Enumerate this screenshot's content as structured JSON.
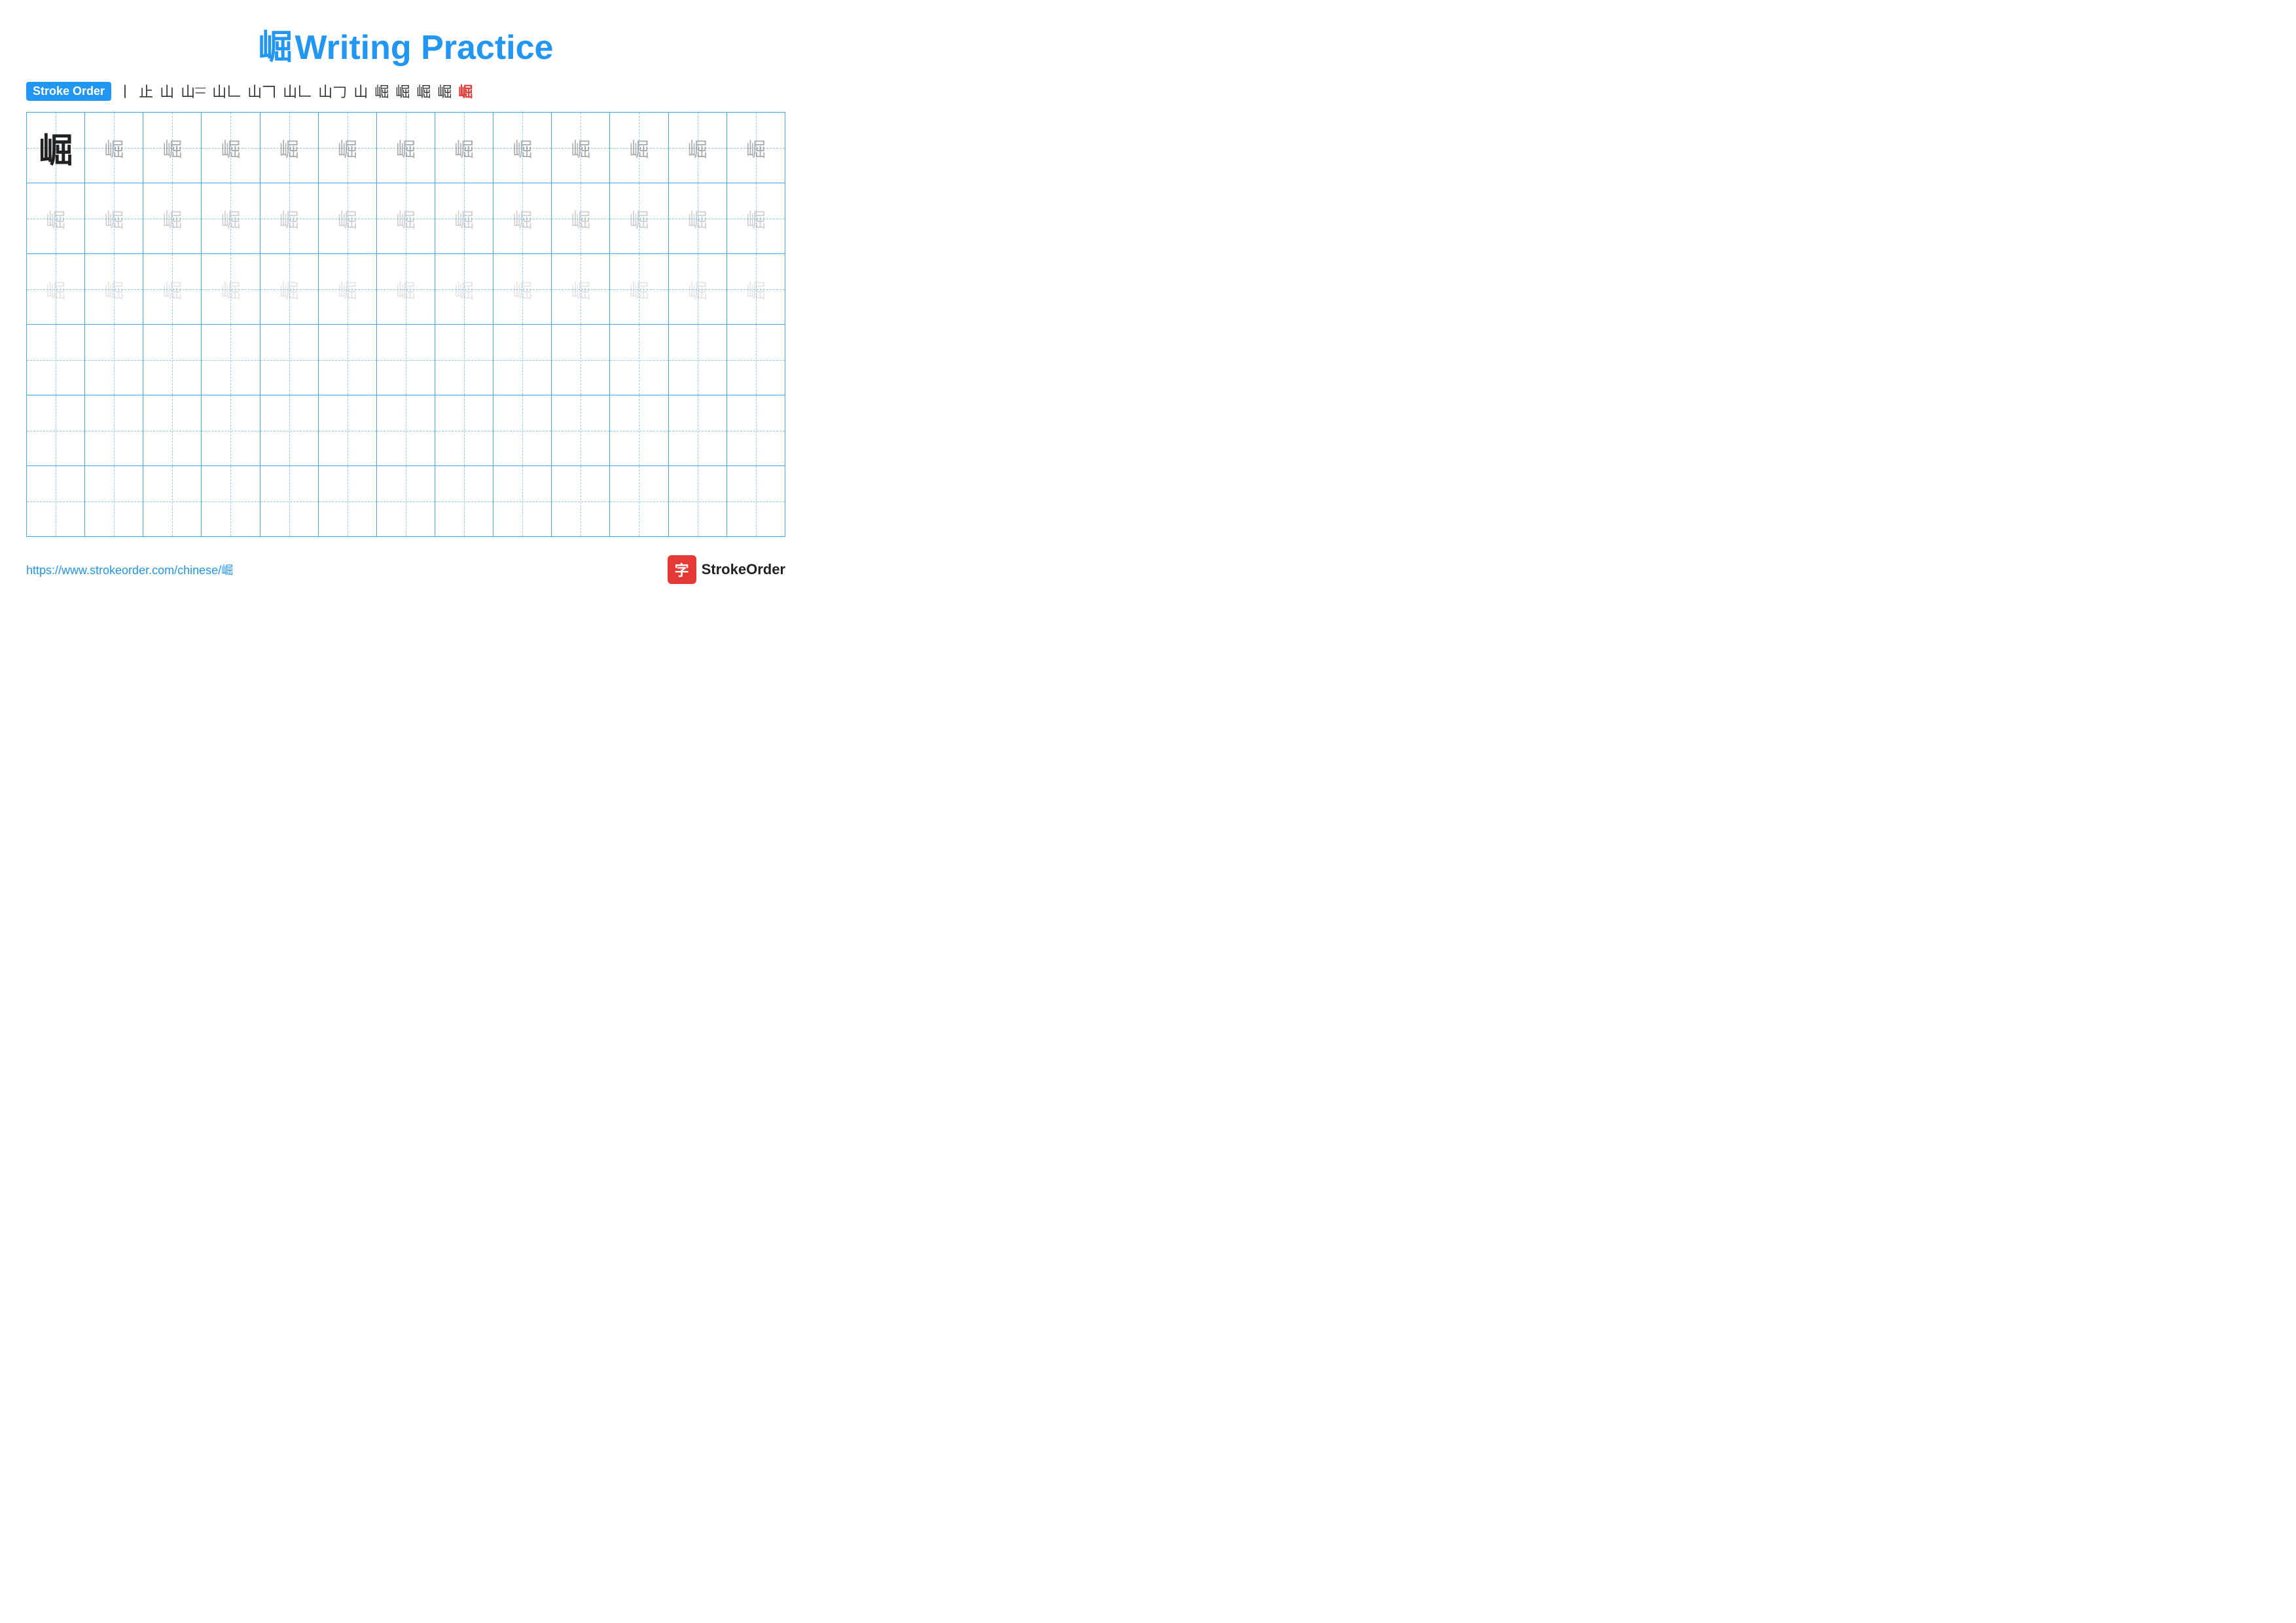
{
  "title": {
    "char": "崛",
    "text": "Writing Practice"
  },
  "stroke_order": {
    "label": "Stroke Order",
    "steps": [
      "丨",
      "止",
      "山",
      "山一",
      "山𠃊",
      "山𠃍",
      "山𠃊",
      "山𠃌",
      "山𠃎",
      "崛𠃎",
      "崛𠃎",
      "崛𠃎",
      "崛𠃎",
      "崛"
    ]
  },
  "grid": {
    "rows": 6,
    "cols": 13
  },
  "footer": {
    "link_text": "https://www.strokeorder.com/chinese/崛",
    "brand_icon": "字",
    "brand_name": "StrokeOrder"
  }
}
